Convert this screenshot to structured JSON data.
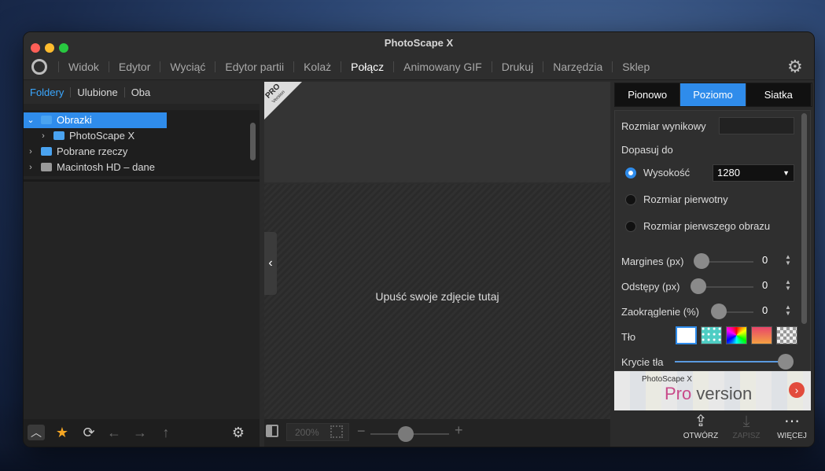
{
  "window": {
    "title": "PhotoScape X"
  },
  "menu": {
    "items": [
      "Widok",
      "Edytor",
      "Wyciąć",
      "Edytor partii",
      "Kolaż",
      "Połącz",
      "Animowany GIF",
      "Drukuj",
      "Narzędzia",
      "Sklep"
    ],
    "active": "Połącz"
  },
  "left": {
    "tabs": [
      "Foldery",
      "Ulubione",
      "Oba"
    ],
    "tree": [
      {
        "label": "Obrazki",
        "expanded": true,
        "selected": true
      },
      {
        "label": "PhotoScape X"
      },
      {
        "label": "Pobrane rzeczy"
      },
      {
        "label": "Macintosh HD – dane"
      }
    ]
  },
  "center": {
    "pro_badge": "PRO",
    "pro_badge_sub": "Version",
    "drop_text": "Upuść swoje zdjęcie tutaj",
    "zoom": "200%"
  },
  "right": {
    "segments": [
      "Pionowo",
      "Poziomo",
      "Siatka"
    ],
    "active_segment": "Poziomo",
    "output_size_label": "Rozmiar wynikowy",
    "fit_to_label": "Dopasuj do",
    "options": [
      "Wysokość",
      "Rozmiar pierwotny",
      "Rozmiar pierwszego obrazu"
    ],
    "selected_option": "Wysokość",
    "height_value": "1280",
    "margins_label": "Margines (px)",
    "margins_value": "0",
    "spacing_label": "Odstępy (px)",
    "spacing_value": "0",
    "rounding_label": "Zaokrąglenie (%)",
    "rounding_value": "0",
    "background_label": "Tło",
    "opacity_label": "Krycie tła",
    "promo_small": "PhotoScape X",
    "promo_pro": "Pro",
    "promo_version": " version"
  },
  "bottom_right": {
    "open": "OTWÓRZ",
    "save": "ZAPISZ",
    "more": "WIĘCEJ"
  },
  "colors": {
    "accent": "#2f8ceb",
    "star": "#f5a623"
  }
}
